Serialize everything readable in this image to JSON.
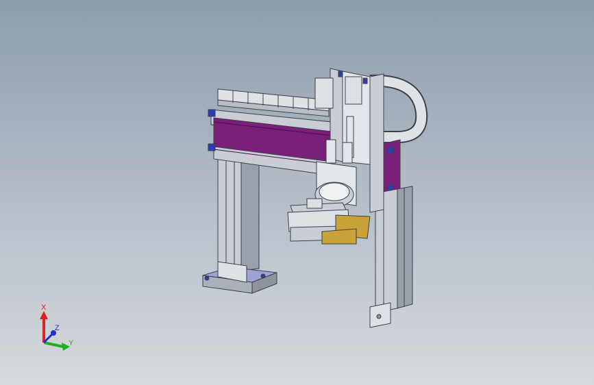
{
  "viewport": {
    "background_top": "#8d9cac",
    "background_bottom": "#d6d9dd"
  },
  "model": {
    "colors": {
      "frame": "#c9ced6",
      "frame_dark": "#8e949e",
      "frame_edge": "#3c4048",
      "plate_purple": "#7a1f7a",
      "plate_purple_dark": "#4a0f4f",
      "cable_chain": "#dfe2e6",
      "base_plate": "#9ea3d6",
      "gripper_gold": "#c9a23a",
      "bolt_blue": "#2f3db5"
    }
  },
  "triad": {
    "x_label": "X",
    "y_label": "Y",
    "z_label": "Z",
    "x_color": "#e02020",
    "y_color": "#20b020",
    "z_color": "#2030d0"
  }
}
